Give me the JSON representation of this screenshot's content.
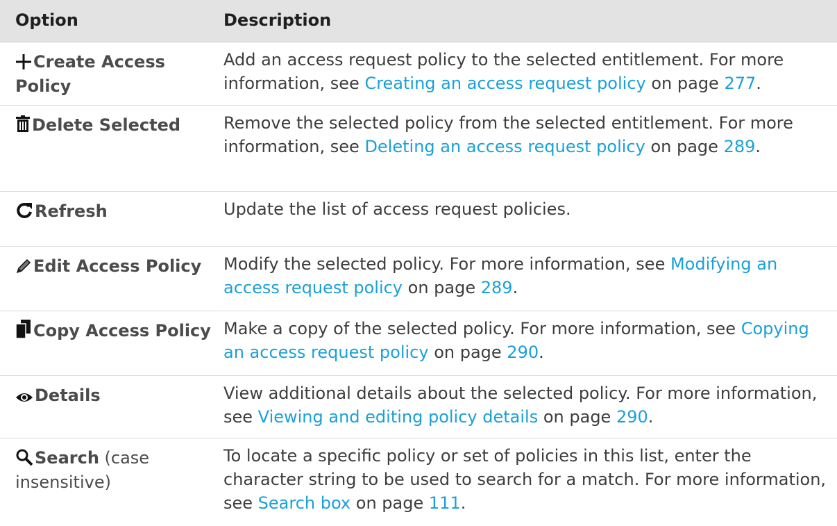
{
  "header": {
    "option": "Option",
    "description": "Description"
  },
  "rows": [
    {
      "icon": "plus-icon",
      "label": "Create Access Policy",
      "suffix": "",
      "desc": [
        "Add an access request policy to the selected entitlement. For more information, see ",
        "Creating an access request policy",
        " on page ",
        "277",
        "."
      ]
    },
    {
      "icon": "trash-icon",
      "label": "Delete Selected",
      "suffix": "",
      "desc": [
        "Remove the selected policy from the selected entitlement. For more information, see ",
        "Deleting an access request policy",
        " on page ",
        "289",
        "."
      ]
    },
    {
      "icon": "refresh-icon",
      "label": "Refresh",
      "suffix": "",
      "desc": [
        "Update the list of access request policies.",
        "",
        "",
        "",
        ""
      ]
    },
    {
      "icon": "pencil-icon",
      "label": "Edit Access Policy",
      "suffix": "",
      "desc": [
        "Modify the selected policy. For more information, see ",
        "Modifying an access request policy",
        " on page ",
        "289",
        "."
      ]
    },
    {
      "icon": "copy-icon",
      "label": "Copy Access Policy",
      "suffix": "",
      "desc": [
        "Make a copy of the selected policy. For more information, see ",
        "Copying an access request policy",
        " on page ",
        "290",
        "."
      ]
    },
    {
      "icon": "eye-icon",
      "label": "Details",
      "suffix": "",
      "desc": [
        "View additional details about the selected policy. For more information, see ",
        "Viewing and editing policy details",
        " on page ",
        "290",
        "."
      ]
    },
    {
      "icon": "search-icon",
      "label": "Search",
      "suffix": " (case insensitive)",
      "desc": [
        "To locate a specific policy or set of policies in this list, enter the character string to be used to search for a match. For more information, see ",
        "Search box",
        " on page ",
        "111",
        "."
      ]
    }
  ]
}
